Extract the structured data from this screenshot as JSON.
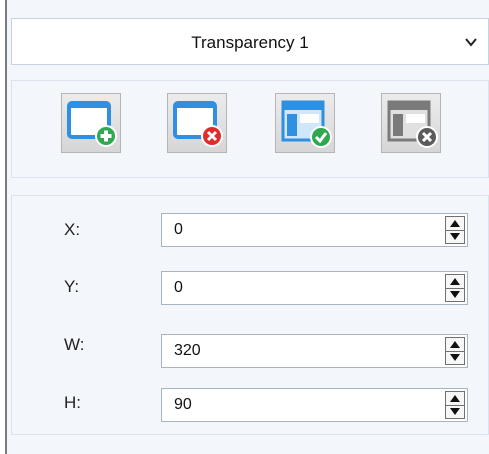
{
  "layer_selector": {
    "selected": "Transparency 1"
  },
  "toolbar": {
    "buttons": [
      {
        "icon": "add-window-icon",
        "color": "#2f8fe0",
        "badge_color": "#2fa84f"
      },
      {
        "icon": "remove-window-icon",
        "color": "#2f8fe0",
        "badge_color": "#e02b2b"
      },
      {
        "icon": "apply-layout-icon",
        "color": "#2f8fe0",
        "badge_color": "#2fa84f"
      },
      {
        "icon": "delete-layout-icon",
        "color": "#7a7a7a",
        "badge_color": "#5a5a5a"
      }
    ]
  },
  "properties": {
    "fields": [
      {
        "label": "X:",
        "value": "0"
      },
      {
        "label": "Y:",
        "value": "0"
      },
      {
        "label": "W:",
        "value": "320"
      },
      {
        "label": "H:",
        "value": "90"
      }
    ]
  }
}
